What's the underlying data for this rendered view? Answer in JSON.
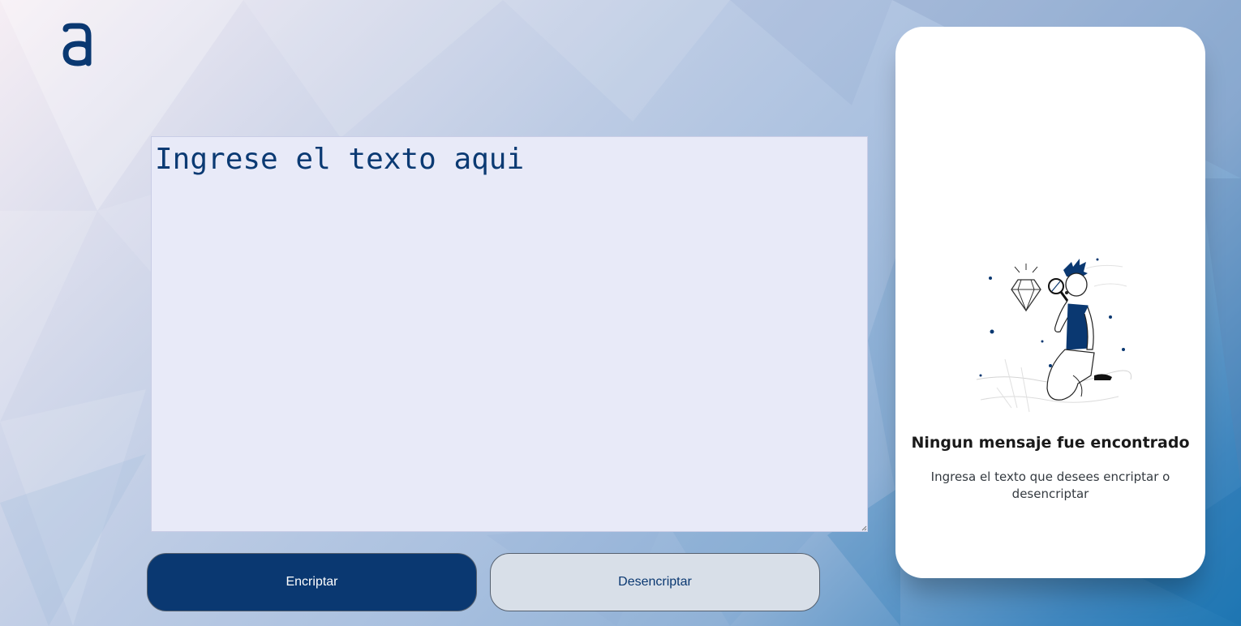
{
  "brand": {
    "logo_icon": "alura-a-logo-icon",
    "color": "#0a3871"
  },
  "editor": {
    "placeholder": "Ingrese el texto aqui",
    "value": ""
  },
  "actions": {
    "encrypt_label": "Encriptar",
    "decrypt_label": "Desencriptar"
  },
  "result_panel": {
    "illustration_icon": "person-magnifying-glass-diamond-illustration",
    "title": "Ningun mensaje fue encontrado",
    "message": "Ingresa el texto que desees encriptar o desencriptar"
  },
  "colors": {
    "primary": "#0a3871",
    "secondary_button": "#d8dfe8",
    "editor_background": "#e8eaf8",
    "card_background": "#ffffff"
  }
}
